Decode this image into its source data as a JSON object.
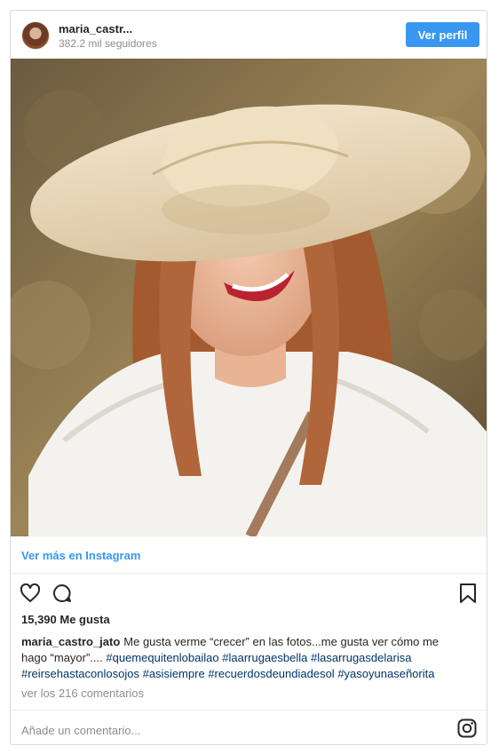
{
  "header": {
    "username": "maria_castr...",
    "followers": "382.2 mil seguidores",
    "profile_button": "Ver perfil"
  },
  "post": {
    "more_link": "Ver más en Instagram",
    "likes": "15,390 Me gusta",
    "caption_author": "maria_castro_jato",
    "caption_text": "Me gusta verme “crecer” en las fotos...me gusta ver cómo me hago “mayor”....",
    "hashtags": [
      "#quemequitenlobailao",
      "#laarrugaesbella",
      "#lasarrugasdelarisa",
      "#reirsehastaconlosojos",
      "#asisiempre",
      "#recuerdosdeundiadesol",
      "#yasoyunaseñorita"
    ],
    "comments_link": "ver los 216 comentarios",
    "comment_placeholder": "Añade un comentario..."
  },
  "icons": [
    "heart-icon",
    "comment-icon",
    "bookmark-icon",
    "instagram-icon"
  ],
  "colors": {
    "accent": "#3897f0",
    "hashtag": "#003569",
    "muted": "#8e8e8e"
  }
}
